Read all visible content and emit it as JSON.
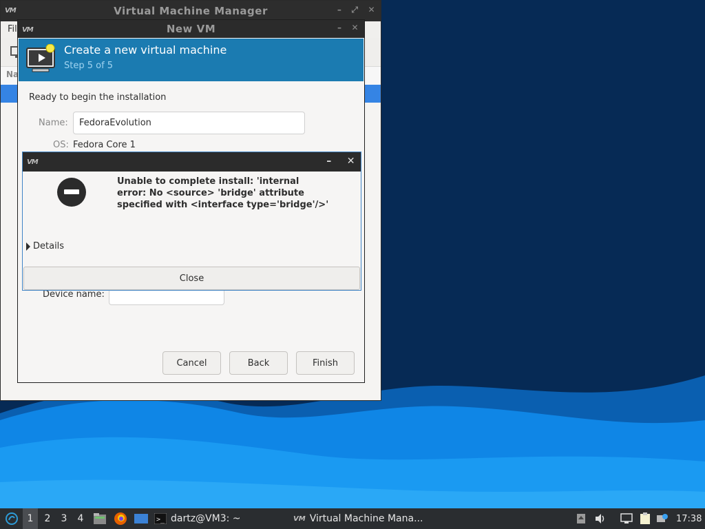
{
  "colors": {
    "desktop_dark": "#062a55",
    "wave_blue": "#0f86e6",
    "header_blue": "#1b7bb1",
    "selection_blue": "#3584e4",
    "titlebar": "#2b2b2b",
    "taskbar": "#2a2d30"
  },
  "vmm_window": {
    "title": "Virtual Machine Manager",
    "logo": "VM",
    "menu_partial": "Fil",
    "column_partial": "Na"
  },
  "newvm": {
    "title": "New VM",
    "logo": "VM",
    "header_title": "Create a new virtual machine",
    "header_step": "Step 5 of 5",
    "ready_label": "Ready to begin the installation",
    "name_label": "Name:",
    "name_value": "FedoraEvolution",
    "os_label": "OS:",
    "os_value": "Fedora Core 1",
    "device_label": "Device name:",
    "buttons": {
      "cancel": "Cancel",
      "back": "Back",
      "finish": "Finish"
    }
  },
  "error_dialog": {
    "logo": "VM",
    "minimize": "–",
    "close_x": "✕",
    "message": "Unable to complete install: 'internal\nerror: No <source> 'bridge' attribute\nspecified with <interface type='bridge'/>'",
    "details_label": "Details",
    "close_button": "Close"
  },
  "taskbar": {
    "workspaces": [
      "1",
      "2",
      "3",
      "4"
    ],
    "active_workspace": "1",
    "tasks": [
      {
        "label": "dartz@VM3: ~",
        "icon": "terminal-icon"
      },
      {
        "label": "Virtual Machine Mana...",
        "icon": "vm-icon"
      }
    ],
    "clock": "17:38"
  }
}
